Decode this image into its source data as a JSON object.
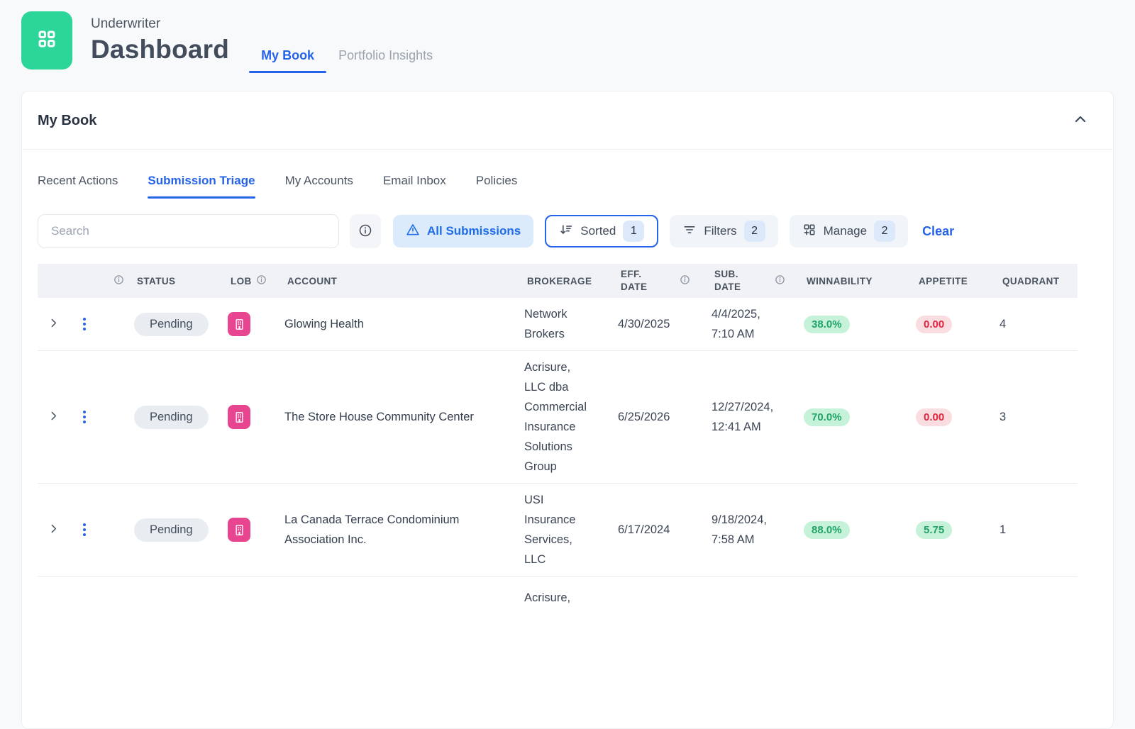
{
  "colors": {
    "accent_blue": "#2563eb",
    "logo_green": "#2bd698",
    "lob_pink": "#e84591",
    "badge_green_bg": "#c6f2da",
    "badge_green_text": "#21a368",
    "badge_red_bg": "#fadde0",
    "badge_red_text": "#df2540",
    "count_badge_bg": "#dbe9fb"
  },
  "header": {
    "subtitle": "Underwriter",
    "title": "Dashboard",
    "tabs": [
      {
        "label": "My Book",
        "active": true
      },
      {
        "label": "Portfolio Insights",
        "active": false
      }
    ]
  },
  "panel": {
    "title": "My Book",
    "tabs": [
      {
        "label": "Recent Actions",
        "active": false
      },
      {
        "label": "Submission Triage",
        "active": true
      },
      {
        "label": "My Accounts",
        "active": false
      },
      {
        "label": "Email Inbox",
        "active": false
      },
      {
        "label": "Policies",
        "active": false
      }
    ],
    "toolbar": {
      "search_placeholder": "Search",
      "all_submissions_label": "All Submissions",
      "sorted_label": "Sorted",
      "sorted_count": "1",
      "filters_label": "Filters",
      "filters_count": "2",
      "manage_label": "Manage",
      "manage_count": "2",
      "clear_label": "Clear"
    },
    "table": {
      "columns": {
        "status": "STATUS",
        "lob": "LOB",
        "account": "ACCOUNT",
        "brokerage": "BROKERAGE",
        "eff_date": "EFF. DATE",
        "sub_date": "SUB. DATE",
        "winnability": "WINNABILITY",
        "appetite": "APPETITE",
        "quadrant": "QUADRANT"
      },
      "rows": [
        {
          "status": "Pending",
          "account": "Glowing Health",
          "brokerage": "Network Brokers",
          "eff_date": "4/30/2025",
          "sub_date": "4/4/2025, 7:10 AM",
          "winnability": "38.0%",
          "winnability_color": "green",
          "appetite": "0.00",
          "appetite_color": "red",
          "quadrant": "4"
        },
        {
          "status": "Pending",
          "account": "The Store House Community Center",
          "brokerage": "Acrisure, LLC dba Commercial Insurance Solutions Group",
          "eff_date": "6/25/2026",
          "sub_date": "12/27/2024, 12:41 AM",
          "winnability": "70.0%",
          "winnability_color": "green",
          "appetite": "0.00",
          "appetite_color": "red",
          "quadrant": "3"
        },
        {
          "status": "Pending",
          "account": "La Canada Terrace Condominium Association Inc.",
          "brokerage": "USI Insurance Services, LLC",
          "eff_date": "6/17/2024",
          "sub_date": "9/18/2024, 7:58 AM",
          "winnability": "88.0%",
          "winnability_color": "green",
          "appetite": "5.75",
          "appetite_color": "green",
          "quadrant": "1"
        }
      ],
      "partial_row_fragment": "Acrisure,"
    }
  },
  "icons": {
    "logo": "grid-icon",
    "collapse": "chevron-up-icon",
    "search_info": "info-circle-icon",
    "all_submissions": "warning-triangle-icon",
    "sorted": "sort-descending-icon",
    "filters": "filter-lines-icon",
    "manage": "grid-plus-icon",
    "row_expand": "chevron-right-icon",
    "row_menu": "kebab-menu-icon",
    "lob": "building-icon",
    "column_info": "info-circle-icon"
  }
}
